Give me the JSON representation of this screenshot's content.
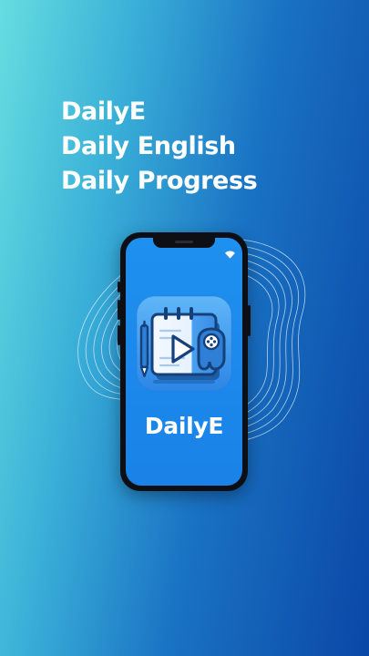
{
  "headline": {
    "line1": "DailyE",
    "line2": "Daily English",
    "line3": "Daily Progress"
  },
  "phone": {
    "app_name": "DailyE",
    "app_icon": "notebook-video-gamepad-icon",
    "status_icon": "wifi-icon"
  },
  "colors": {
    "bg_left": "#66dde0",
    "bg_right": "#0a47a6",
    "screen": "#1e90ef",
    "icon_dark": "#16407a"
  }
}
